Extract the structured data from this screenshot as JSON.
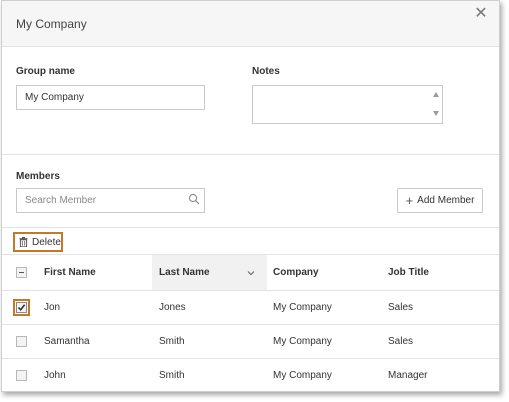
{
  "dialog": {
    "title": "My Company",
    "close_icon": "close-icon"
  },
  "form": {
    "group_name_label": "Group name",
    "group_name_value": "My Company",
    "notes_label": "Notes",
    "notes_value": ""
  },
  "members": {
    "label": "Members",
    "search_placeholder": "Search Member",
    "search_icon": "search-icon",
    "add_member_label": "Add Member",
    "add_icon": "plus-icon"
  },
  "toolbar": {
    "delete_label": "Delete",
    "delete_icon": "trash-icon"
  },
  "table": {
    "columns": [
      "First Name",
      "Last Name",
      "Company",
      "Job Title"
    ],
    "sorted_column": "Last Name",
    "header_checkbox": "indeterminate",
    "rows": [
      {
        "first_name": "Jon",
        "last_name": "Jones",
        "company": "My Company",
        "job_title": "Sales",
        "checked": true
      },
      {
        "first_name": "Samantha",
        "last_name": "Smith",
        "company": "My Company",
        "job_title": "Sales",
        "checked": false
      },
      {
        "first_name": "John",
        "last_name": "Smith",
        "company": "My Company",
        "job_title": "Manager",
        "checked": false
      }
    ]
  },
  "colors": {
    "highlight": "#c5782a",
    "header_bg": "#f6f6f6",
    "border": "#c9c9c9"
  }
}
